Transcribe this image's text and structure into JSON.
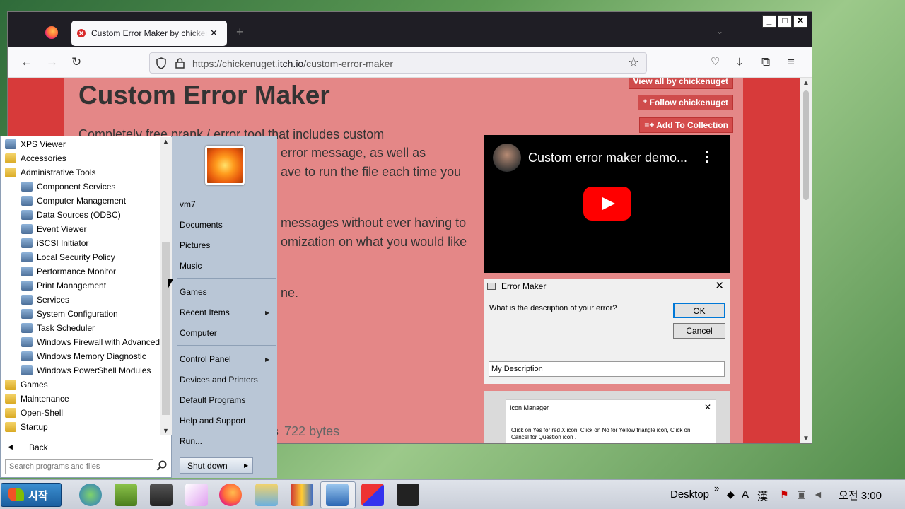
{
  "browser": {
    "tab_title": "Custom Error Maker by chickenuget",
    "url_plain": "https://chickenuget.",
    "url_domain": "itch.io",
    "url_path": "/custom-error-maker",
    "window_buttons": [
      "_",
      "□",
      "✕"
    ]
  },
  "page": {
    "title": "Custom Error Maker",
    "view_all_label": "View all by chickenuget",
    "follow_label": "Follow chickenuget",
    "add_collection_label": "Add To Collection",
    "description_lines": [
      "Completely free prank / error tool that  includes custom",
      "error message,  as well as",
      "ave to run the file each time you",
      "messages without ever having to",
      "omization on what you would like",
      "ne."
    ],
    "file_name": "vbs",
    "file_size": "722 bytes",
    "video": {
      "title": "Custom error maker demo..."
    },
    "error_maker": {
      "title": "Error Maker",
      "question": "What is the description of your error?",
      "ok": "OK",
      "cancel": "Cancel",
      "input_value": "My Description"
    },
    "icon_manager": {
      "title": "Icon Manager",
      "text": "Click on Yes for red X icon, Click on No for Yellow triangle icon, Click on Cancel for Question icon ."
    }
  },
  "start_menu": {
    "programs": [
      {
        "label": "XPS Viewer",
        "level": "top",
        "icon": "xps-viewer-icon"
      },
      {
        "label": "Accessories",
        "level": "top",
        "icon": "folder-icon"
      },
      {
        "label": "Administrative Tools",
        "level": "top",
        "icon": "folder-icon"
      },
      {
        "label": "Component Services",
        "level": "sub",
        "icon": "component-services-icon"
      },
      {
        "label": "Computer Management",
        "level": "sub",
        "icon": "computer-management-icon"
      },
      {
        "label": "Data Sources (ODBC)",
        "level": "sub",
        "icon": "data-sources-icon"
      },
      {
        "label": "Event Viewer",
        "level": "sub",
        "icon": "event-viewer-icon"
      },
      {
        "label": "iSCSI Initiator",
        "level": "sub",
        "icon": "iscsi-icon"
      },
      {
        "label": "Local Security Policy",
        "level": "sub",
        "icon": "security-policy-icon"
      },
      {
        "label": "Performance Monitor",
        "level": "sub",
        "icon": "performance-monitor-icon"
      },
      {
        "label": "Print Management",
        "level": "sub",
        "icon": "print-management-icon"
      },
      {
        "label": "Services",
        "level": "sub",
        "icon": "services-icon"
      },
      {
        "label": "System Configuration",
        "level": "sub",
        "icon": "system-configuration-icon"
      },
      {
        "label": "Task Scheduler",
        "level": "sub",
        "icon": "task-scheduler-icon"
      },
      {
        "label": "Windows Firewall with Advanced",
        "level": "sub",
        "icon": "firewall-icon"
      },
      {
        "label": "Windows Memory Diagnostic",
        "level": "sub",
        "icon": "memory-diagnostic-icon"
      },
      {
        "label": "Windows PowerShell Modules",
        "level": "sub",
        "icon": "powershell-icon"
      },
      {
        "label": "Games",
        "level": "top",
        "icon": "folder-icon"
      },
      {
        "label": "Maintenance",
        "level": "top",
        "icon": "folder-icon"
      },
      {
        "label": "Open-Shell",
        "level": "top",
        "icon": "folder-icon"
      },
      {
        "label": "Startup",
        "level": "top",
        "icon": "folder-icon"
      }
    ],
    "back_label": "Back",
    "search_placeholder": "Search programs and files",
    "right": {
      "user": "vm7",
      "documents": "Documents",
      "pictures": "Pictures",
      "music": "Music",
      "games": "Games",
      "recent_items": "Recent Items",
      "computer": "Computer",
      "control_panel": "Control Panel",
      "devices_printers": "Devices and Printers",
      "default_programs": "Default Programs",
      "help_support": "Help and Support",
      "run": "Run..."
    },
    "shutdown_label": "Shut down"
  },
  "taskbar": {
    "start_label": "시작",
    "desktop_label": "Desktop",
    "ime_a": "A",
    "ime_han": "漢",
    "clock": "오전 3:00",
    "overflow": "»"
  }
}
